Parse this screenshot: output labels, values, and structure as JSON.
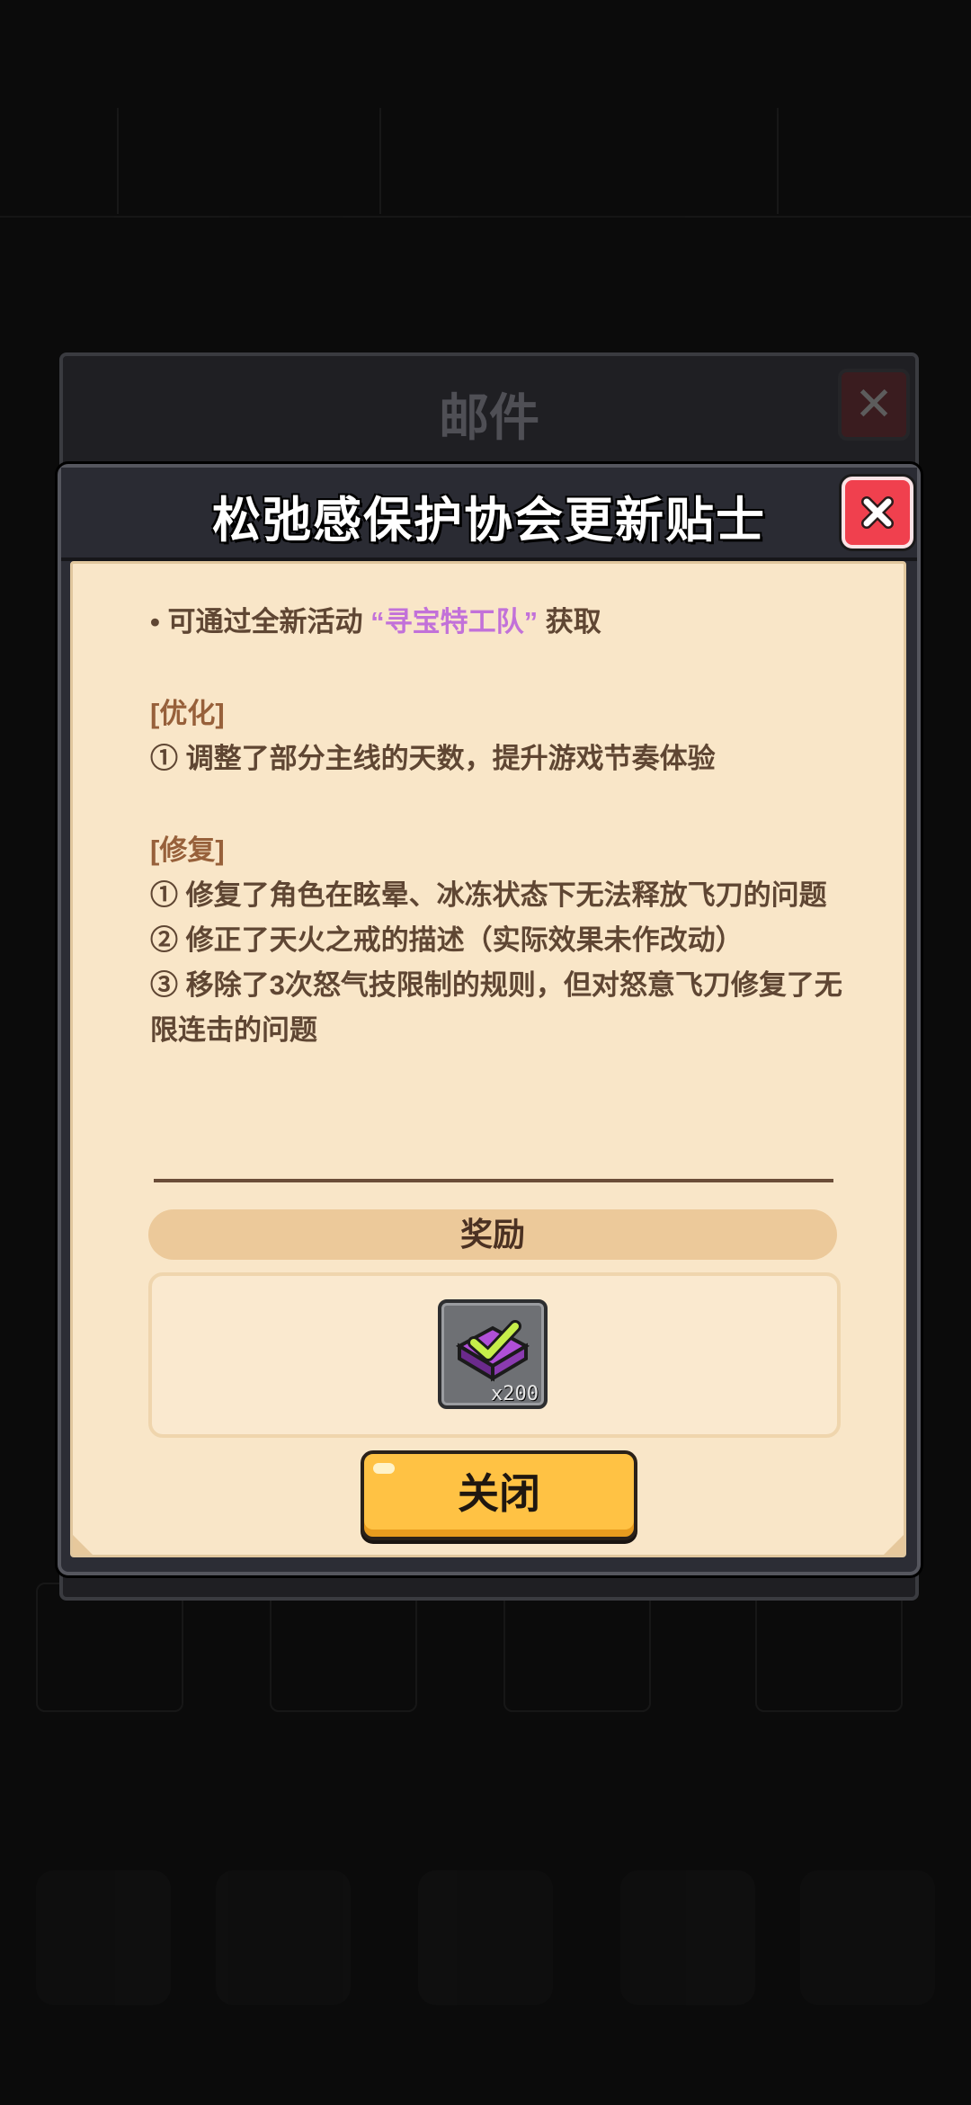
{
  "background": {
    "mail_title": "邮件"
  },
  "dialog": {
    "title": "松弛感保护协会更新贴士",
    "notes": {
      "bullet_prefix": "• 可通过全新活动",
      "activity_name": "“寻宝特工队”",
      "bullet_suffix": "获取",
      "optimize_header": "[优化]",
      "optimize_items": [
        "① 调整了部分主线的天数，提升游戏节奏体验"
      ],
      "fix_header": "[修复]",
      "fix_items": [
        "① 修复了角色在眩晕、冰冻状态下无法释放飞刀的问题",
        "② 修正了天火之戒的描述（实际效果未作改动）",
        "③ 移除了3次怒气技限制的规则，但对怒意飞刀修复了无限连击的问题"
      ]
    },
    "reward_label": "奖励",
    "reward": {
      "icon": "purple-gem-check-icon",
      "count": "x200"
    },
    "close_label": "关闭"
  },
  "colors": {
    "paper": "#f9e6c8",
    "text": "#5f4633",
    "section": "#97603a",
    "highlight": "#c271d9",
    "button": "#ffc244",
    "close_x": "#f0404e"
  }
}
